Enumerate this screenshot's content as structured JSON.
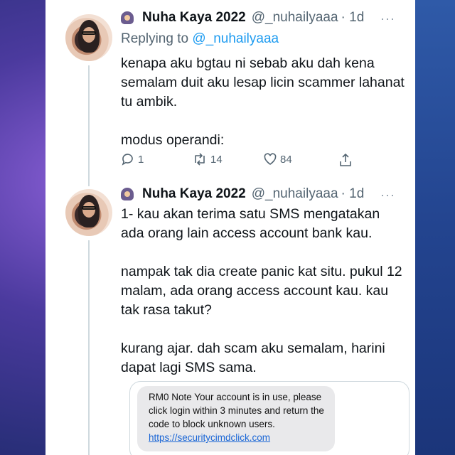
{
  "tweets": [
    {
      "author_name": "Nuha Kaya 2022",
      "handle": "@_nuhailyaaa",
      "age": "· 1d",
      "more": "···",
      "reply_prefix": "Replying to",
      "reply_mention": "@_nuhailyaaa",
      "text": "kenapa aku bgtau ni sebab aku dah kena semalam duit aku lesap licin scammer lahanat tu ambik.\n\nmodus operandi:",
      "actions": {
        "replies": "1",
        "retweets": "14",
        "likes": "84"
      }
    },
    {
      "author_name": "Nuha Kaya 2022",
      "handle": "@_nuhailyaaa",
      "age": "· 1d",
      "more": "···",
      "text": "1- kau akan terima satu SMS mengatakan ada orang lain access account bank kau.\n\nnampak tak dia create panic kat situ. pukul 12 malam, ada orang access account kau. kau tak rasa takut?\n\nkurang ajar. dah scam aku semalam, harini dapat lagi SMS sama.",
      "sms": {
        "message": "RM0 Note Your account is in use, please click login within 3 minutes and return the code to block unknown users.",
        "link": "https://securitycimdclick.com"
      }
    }
  ],
  "icons": {
    "reply": "reply-icon",
    "retweet": "retweet-icon",
    "like": "heart-icon",
    "share": "share-icon"
  },
  "colors": {
    "link": "#1d9bf0",
    "text": "#0f1419",
    "muted": "#536471"
  }
}
